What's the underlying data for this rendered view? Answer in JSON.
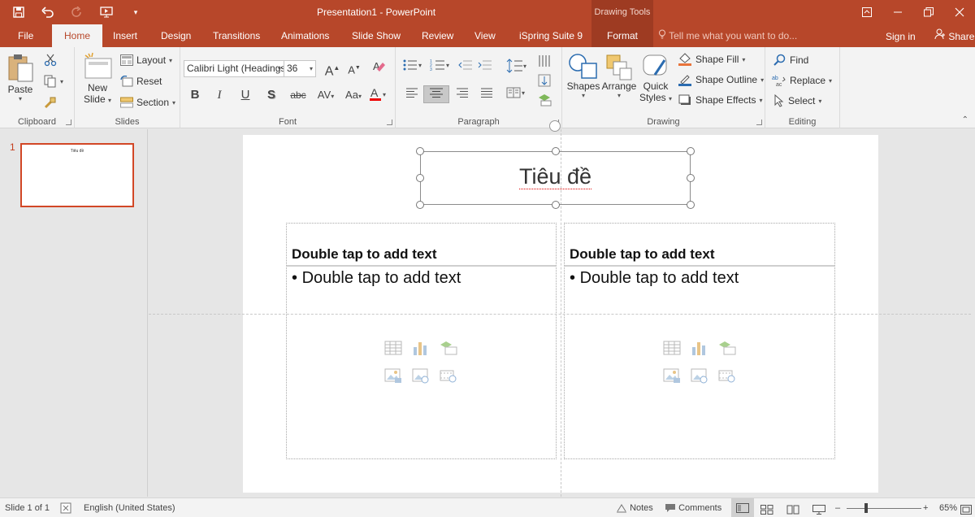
{
  "window": {
    "title": "Presentation1 - PowerPoint",
    "context_tab_header": "Drawing Tools"
  },
  "tabs": [
    {
      "label": "File"
    },
    {
      "label": "Home"
    },
    {
      "label": "Insert"
    },
    {
      "label": "Design"
    },
    {
      "label": "Transitions"
    },
    {
      "label": "Animations"
    },
    {
      "label": "Slide Show"
    },
    {
      "label": "Review"
    },
    {
      "label": "View"
    },
    {
      "label": "iSpring Suite 9"
    },
    {
      "label": "Format"
    }
  ],
  "tell_me": "Tell me what you want to do...",
  "sign_in": "Sign in",
  "share": "Share",
  "ribbon": {
    "clipboard": {
      "label": "Clipboard",
      "paste": "Paste"
    },
    "slides": {
      "label": "Slides",
      "new_slide_line1": "New",
      "new_slide_line2": "Slide",
      "layout": "Layout",
      "reset": "Reset",
      "section": "Section"
    },
    "font": {
      "label": "Font",
      "font_name": "Calibri Light (Headings",
      "font_size": "36",
      "bold": "B",
      "italic": "I",
      "underline": "U",
      "shadow": "S",
      "strike": "abc",
      "spacing": "AV",
      "case": "Aa"
    },
    "paragraph": {
      "label": "Paragraph"
    },
    "drawing": {
      "label": "Drawing",
      "shapes": "Shapes",
      "arrange": "Arrange",
      "quick_styles_1": "Quick",
      "quick_styles_2": "Styles",
      "shape_fill": "Shape Fill",
      "shape_outline": "Shape Outline",
      "shape_effects": "Shape Effects"
    },
    "editing": {
      "label": "Editing",
      "find": "Find",
      "replace": "Replace",
      "select": "Select"
    }
  },
  "thumbnails": [
    {
      "number": "1",
      "title": "Tiêu đề"
    }
  ],
  "slide": {
    "title": "Tiêu đề",
    "left_placeholder": {
      "heading": "Double tap to add text",
      "bullet": "Double tap to add text"
    },
    "right_placeholder": {
      "heading": "Double tap to add text",
      "bullet": "Double tap to add text"
    }
  },
  "status": {
    "slide_info": "Slide 1 of 1",
    "language": "English (United States)",
    "notes": "Notes",
    "comments": "Comments",
    "zoom": "65%"
  },
  "colors": {
    "brand": "#b7472a",
    "context_tab": "#9e3b22",
    "selection": "#d24726"
  }
}
